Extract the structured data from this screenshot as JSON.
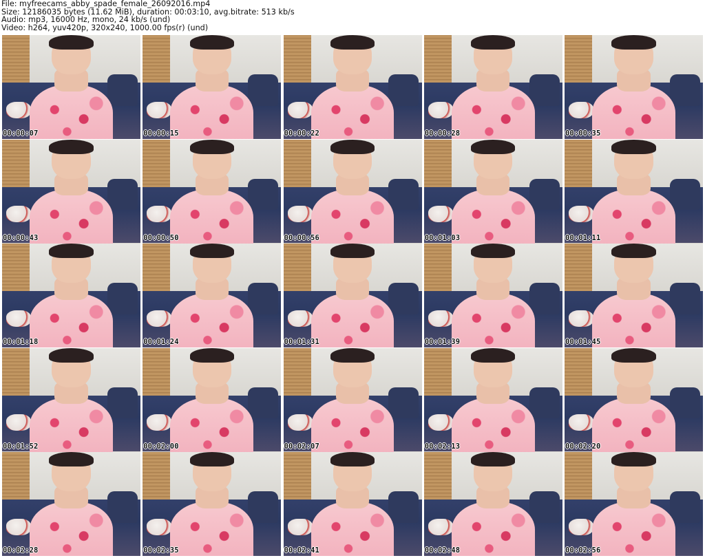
{
  "header": {
    "file_line": "File: myfreecams_abby_spade_female_26092016.mp4",
    "size_line": "Size: 12186035 bytes (11.62 MiB), duration: 00:03:10, avg.bitrate: 513 kb/s",
    "audio_line": "Audio: mp3, 16000 Hz, mono, 24 kb/s (und)",
    "video_line": "Video: h264, yuv420p, 320x240, 1000.00 fps(r) (und)"
  },
  "thumbnails": [
    {
      "timestamp": "00:00:07"
    },
    {
      "timestamp": "00:00:15"
    },
    {
      "timestamp": "00:00:22"
    },
    {
      "timestamp": "00:00:28"
    },
    {
      "timestamp": "00:00:35"
    },
    {
      "timestamp": "00:00:43"
    },
    {
      "timestamp": "00:00:50"
    },
    {
      "timestamp": "00:00:56"
    },
    {
      "timestamp": "00:01:03"
    },
    {
      "timestamp": "00:01:11"
    },
    {
      "timestamp": "00:01:18"
    },
    {
      "timestamp": "00:01:24"
    },
    {
      "timestamp": "00:01:31"
    },
    {
      "timestamp": "00:01:39"
    },
    {
      "timestamp": "00:01:45"
    },
    {
      "timestamp": "00:01:52"
    },
    {
      "timestamp": "00:02:00"
    },
    {
      "timestamp": "00:02:07"
    },
    {
      "timestamp": "00:02:13"
    },
    {
      "timestamp": "00:02:20"
    },
    {
      "timestamp": "00:02:28"
    },
    {
      "timestamp": "00:02:35"
    },
    {
      "timestamp": "00:02:41"
    },
    {
      "timestamp": "00:02:48"
    },
    {
      "timestamp": "00:02:56"
    }
  ]
}
